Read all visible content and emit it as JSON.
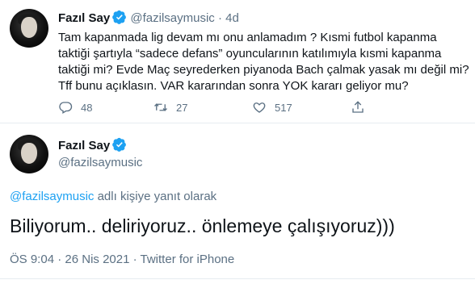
{
  "tweet1": {
    "name": "Fazıl Say",
    "handle": "@fazilsaymusic",
    "time": "· 4d",
    "lines": [
      "Tam kapanmada lig devam mı onu anlamadım ? Kısmi futbol kapanma",
      "taktiği şartıyla “sadece defans” oyuncularının katılımıyla kısmi kapanma",
      "taktiği mi? Evde Maç seyrederken piyanoda Bach çalmak yasak mı değil mi?",
      "Tff bunu açıklasın. VAR kararından sonra YOK kararı geliyor mu?"
    ],
    "reply_count": "48",
    "retweet_count": "27",
    "like_count": "517"
  },
  "tweet2": {
    "name": "Fazıl Say",
    "handle": "@fazilsaymusic",
    "replying_to": "@fazilsaymusic",
    "replying_suffix": " adlı kişiye yanıt olarak",
    "text": "Biliyorum.. deliriyoruz.. önlemeye çalışıyoruz)))",
    "time": "ÖS 9:04",
    "date": "26 Nis 2021",
    "source": "Twitter for iPhone"
  },
  "colors": {
    "accent": "#1da1f2",
    "muted": "#5b7083",
    "text": "#0f1419"
  },
  "icons": [
    "verified-badge-icon",
    "reply-icon",
    "retweet-icon",
    "like-icon",
    "share-icon"
  ]
}
